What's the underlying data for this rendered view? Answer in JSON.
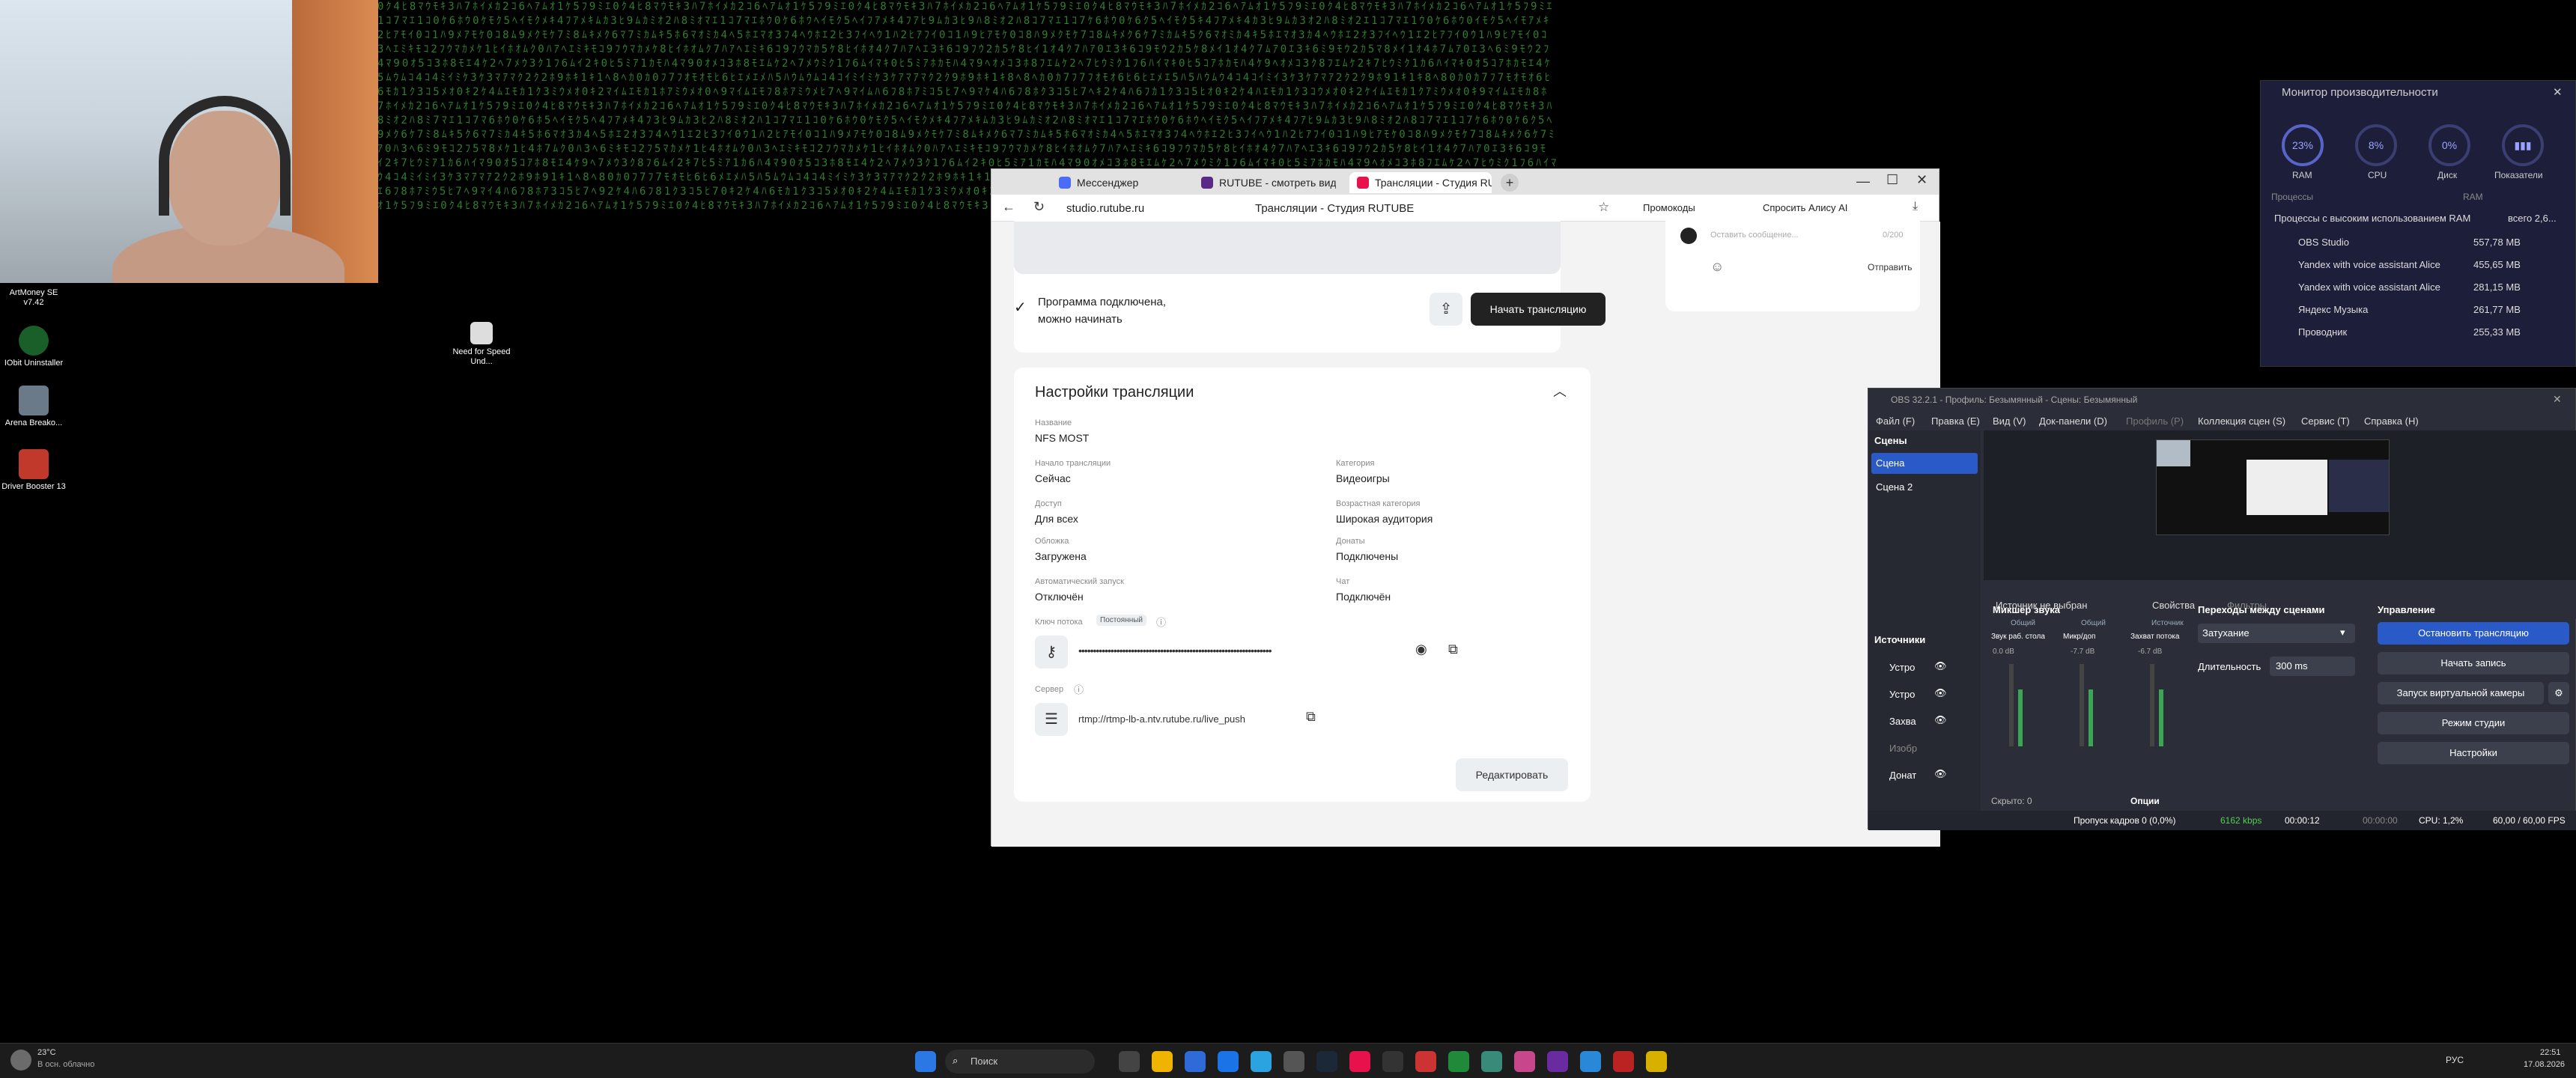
{
  "desktop": {
    "icons": [
      {
        "label": "ArtMoney SE v7.42"
      },
      {
        "label": "IObit Uninstaller"
      },
      {
        "label": "Arena Breako..."
      },
      {
        "label": "Driver Booster 13"
      },
      {
        "label": "Need for Speed Und..."
      }
    ]
  },
  "browser": {
    "tabs": [
      {
        "label": "Мессенджер"
      },
      {
        "label": "RUTUBE - смотреть видео"
      },
      {
        "label": "Трансляции - Студия RUTUBE"
      }
    ],
    "address": "studio.rutube.ru",
    "page_title": "Трансляции - Студия RUTUBE",
    "promo": "Промокоды",
    "ask_alice": "Спросить Алису AI",
    "comment_placeholder": "Оставить сообщение...",
    "comment_counter": "0/200",
    "send": "Отправить",
    "status_line1": "Программа подключена,",
    "status_line2": "можно начинать",
    "start_button": "Начать трансляцию",
    "settings_title": "Настройки трансляции",
    "fields": {
      "name_label": "Название",
      "name_value": "NFS MOST",
      "start_label": "Начало трансляции",
      "start_value": "Сейчас",
      "category_label": "Категория",
      "category_value": "Видеоигры",
      "access_label": "Доступ",
      "access_value": "Для всех",
      "age_label": "Возрастная категория",
      "age_value": "Широкая аудитория",
      "cover_label": "Обложка",
      "cover_value": "Загружена",
      "donate_label": "Донаты",
      "donate_value": "Подключены",
      "autostart_label": "Автоматический запуск",
      "autostart_value": "Отключён",
      "chat_label": "Чат",
      "chat_value": "Подключён",
      "key_label": "Ключ потока",
      "key_badge": "Постоянный",
      "key_mask": "••••••••••••••••••••••••••••••••••••••••••••••••••••••••••••••••••",
      "server_label": "Сервер",
      "server_value": "rtmp://rtmp-lb-a.ntv.rutube.ru/live_push"
    },
    "edit_button": "Редактировать"
  },
  "perf": {
    "title": "Монитор производительности",
    "gauges": [
      {
        "value": "23%",
        "label": "RAM"
      },
      {
        "value": "8%",
        "label": "CPU"
      },
      {
        "value": "0%",
        "label": "Диск"
      },
      {
        "value": "",
        "label": "Показатели"
      }
    ],
    "col_processes": "Процессы",
    "col_ram": "RAM",
    "filter": "Процессы с высоким использованием RAM",
    "total": "всего 2,6...",
    "rows": [
      {
        "name": "OBS Studio",
        "ram": "557,78 MB"
      },
      {
        "name": "Yandex with voice assistant Alice",
        "ram": "455,65 MB"
      },
      {
        "name": "Yandex with voice assistant Alice",
        "ram": "281,15 MB"
      },
      {
        "name": "Яндекс Музыка",
        "ram": "261,77 MB"
      },
      {
        "name": "Проводник",
        "ram": "255,33 MB"
      }
    ]
  },
  "obs": {
    "title": "OBS 32.2.1 - Профиль: Безымянный - Сцены: Безымянный",
    "menu": [
      "Файл (F)",
      "Правка (E)",
      "Вид (V)",
      "Док-панели (D)",
      "Профиль (P)",
      "Коллекция сцен (S)",
      "Сервис (T)",
      "Справка (H)"
    ],
    "scenes_title": "Сцены",
    "scenes": [
      "Сцена",
      "Сцена 2"
    ],
    "no_source": "Источник не выбран",
    "properties": "Свойства",
    "filters": "Фильтры",
    "sources_title": "Источники",
    "sources": [
      "Устро",
      "Устро",
      "Захва",
      "Изобр",
      "Донат"
    ],
    "mixer_title": "Микшер звука",
    "mixer_channels": [
      {
        "badge": "Общий",
        "db": "0.0 dB",
        "name": "Звук раб. стола"
      },
      {
        "badge": "Общий",
        "db": "-7.7 dB",
        "name": "Микр/доп"
      },
      {
        "badge": "Источник",
        "db": "-6.7 dB",
        "name": "Захват потока"
      }
    ],
    "hidden": "Скрыто: 0",
    "options": "Опции",
    "transitions_title": "Переходы между сценами",
    "transition": "Затухание",
    "duration_label": "Длительность",
    "duration": "300 ms",
    "controls_title": "Управление",
    "controls": [
      "Остановить трансляцию",
      "Начать запись",
      "Запуск виртуальной камеры",
      "Режим студии",
      "Настройки"
    ],
    "status": {
      "dropped": "Пропуск кадров 0 (0,0%)",
      "bitrate": "6162 kbps",
      "live_time": "00:00:12",
      "rec_time": "00:00:00",
      "cpu": "CPU: 1,2%",
      "fps": "60,00 / 60,00 FPS"
    }
  },
  "taskbar": {
    "weather_temp": "23°C",
    "weather_desc": "В осн. облачно",
    "search": "Поиск",
    "lang": "РУС",
    "time": "22:51",
    "date": "17.08.2026"
  }
}
